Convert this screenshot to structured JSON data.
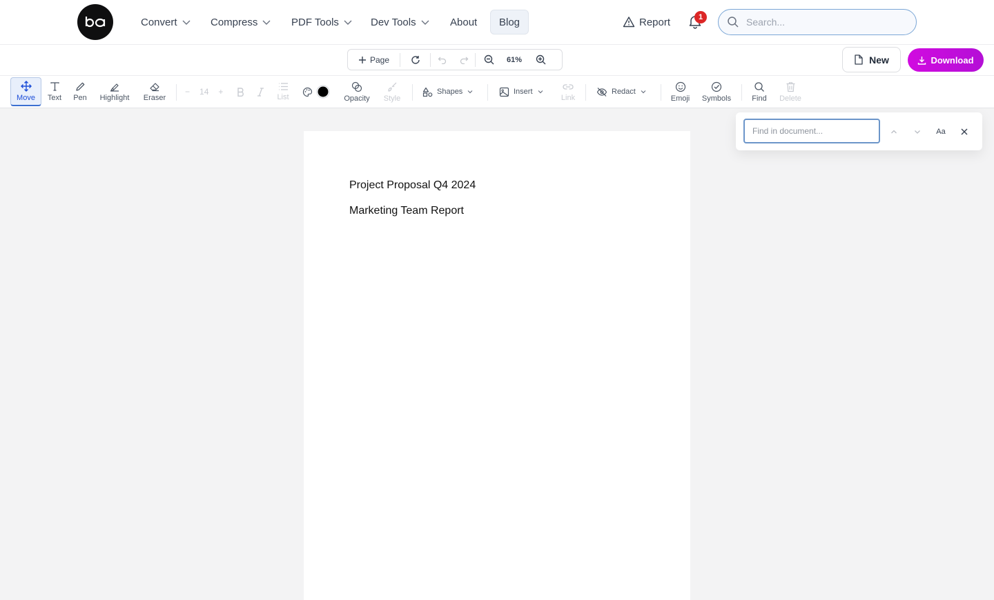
{
  "nav": {
    "items": [
      {
        "label": "Convert",
        "dropdown": true
      },
      {
        "label": "Compress",
        "dropdown": true
      },
      {
        "label": "PDF Tools",
        "dropdown": true
      },
      {
        "label": "Dev Tools",
        "dropdown": true
      },
      {
        "label": "About",
        "dropdown": false
      },
      {
        "label": "Blog",
        "dropdown": false,
        "active": true
      }
    ],
    "report_label": "Report",
    "notification_count": "1",
    "search_placeholder": "Search..."
  },
  "pagebar": {
    "add_page_label": "Page",
    "zoom": "61%",
    "new_label": "New",
    "download_label": "Download"
  },
  "toolbar": {
    "move": "Move",
    "text": "Text",
    "pen": "Pen",
    "highlight": "Highlight",
    "eraser": "Eraser",
    "font_size": "14",
    "list": "List",
    "opacity": "Opacity",
    "style": "Style",
    "shapes": "Shapes",
    "insert": "Insert",
    "link": "Link",
    "redact": "Redact",
    "emoji": "Emoji",
    "symbols": "Symbols",
    "find": "Find",
    "delete": "Delete",
    "current_color": "#000000"
  },
  "document": {
    "lines": [
      "Project Proposal Q4 2024",
      "Marketing Team Report"
    ]
  },
  "find_panel": {
    "placeholder": "Find in document...",
    "match_case_label": "Aa"
  },
  "colors": {
    "accent": "#3b6fd1",
    "download_gradient_start": "#d10be0",
    "download_gradient_end": "#b40fd6",
    "badge": "#dc2626"
  }
}
